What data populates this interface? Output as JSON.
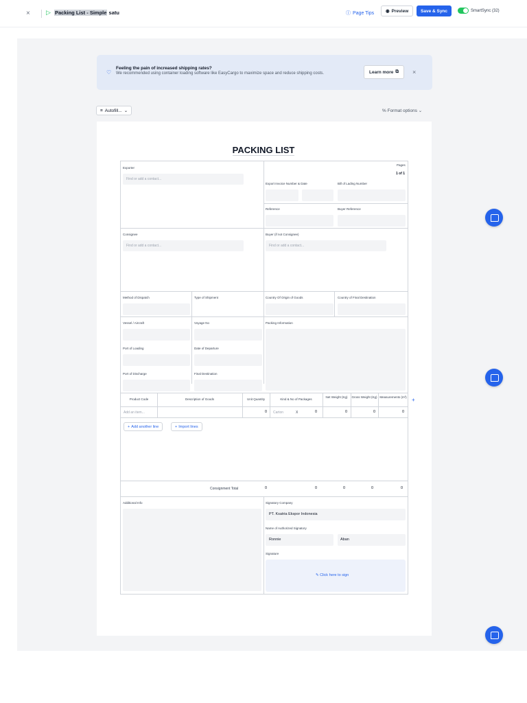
{
  "topbar": {
    "close": "×",
    "title_highlight": "Packing List - Simple",
    "title_rest": " satu",
    "page_tips": "Page Tips",
    "preview": "Preview",
    "save_sync": "Save & Sync",
    "smartsync": "SmartSync (32)"
  },
  "banner": {
    "title": "Feeling the pain of increased shipping rates?",
    "subtitle": "We recommended using container loading software like EasyCargo to maximize space and reduce shipping costs.",
    "learn_more": "Learn more",
    "close": "×"
  },
  "toolbar": {
    "autofill": "Autofill...",
    "format_options": "Format options"
  },
  "document": {
    "title": "PACKING LIST",
    "exporter": {
      "label": "Exporter",
      "placeholder": "Find or add a contact..."
    },
    "pages": {
      "label": "Pages",
      "value": "1 of 1"
    },
    "export_invoice": "Export Invoice Number & Date",
    "bill_of_lading": "Bill of Lading Number",
    "reference": "Reference",
    "buyer_reference": "Buyer Reference",
    "consignee": {
      "label": "Consignee",
      "placeholder": "Find or add a contact..."
    },
    "buyer": {
      "label": "Buyer (if not Consignee)",
      "placeholder": "Find or add a contact..."
    },
    "method_dispatch": "Method of Dispatch",
    "type_shipment": "Type of Shipment",
    "country_origin": "Country Of Origin of Goods",
    "country_destination": "Country of Final Destination",
    "vessel": "Vessel / Aircraft",
    "voyage": "Voyage No",
    "packing_info": "Packing Information",
    "port_loading": "Port of Loading",
    "date_departure": "Date of Departure",
    "port_discharge": "Port of Discharge",
    "final_destination": "Final Destination",
    "table": {
      "headers": {
        "product_code": "Product Code",
        "description": "Description of Goods",
        "unit_qty": "Unit Quantity",
        "kind_packages": "Kind & No of Packages",
        "net_weight": "Net Weight (Kg)",
        "gross_weight": "Gross Weight (Kg)",
        "measurements": "Measurements (m³)"
      },
      "row": {
        "product_placeholder": "Add an item...",
        "unit_qty": "0",
        "package_kind": "Carton",
        "package_x": "X",
        "package_no": "0",
        "net": "0",
        "gross": "0",
        "meas": "0"
      },
      "add_line": "Add another line",
      "import_lines": "Import lines",
      "totals": {
        "label": "Consignment Total",
        "unit": "0",
        "packages": "0",
        "net": "0",
        "gross": "0",
        "meas": "0"
      }
    },
    "additional_info": "Additional Info",
    "signatory_company": {
      "label": "Signatory Company",
      "value": "PT. Ksatria Ekspor Indonesia"
    },
    "authorized_signatory": {
      "label": "Name of Authorized Signatory",
      "first": "Ronnie",
      "last": "Aban"
    },
    "signature": {
      "label": "Signature",
      "action": "Click here to sign"
    }
  },
  "colors": {
    "accent": "#2563eb",
    "toggle": "#22c55e",
    "banner": "#e3eaf7"
  }
}
